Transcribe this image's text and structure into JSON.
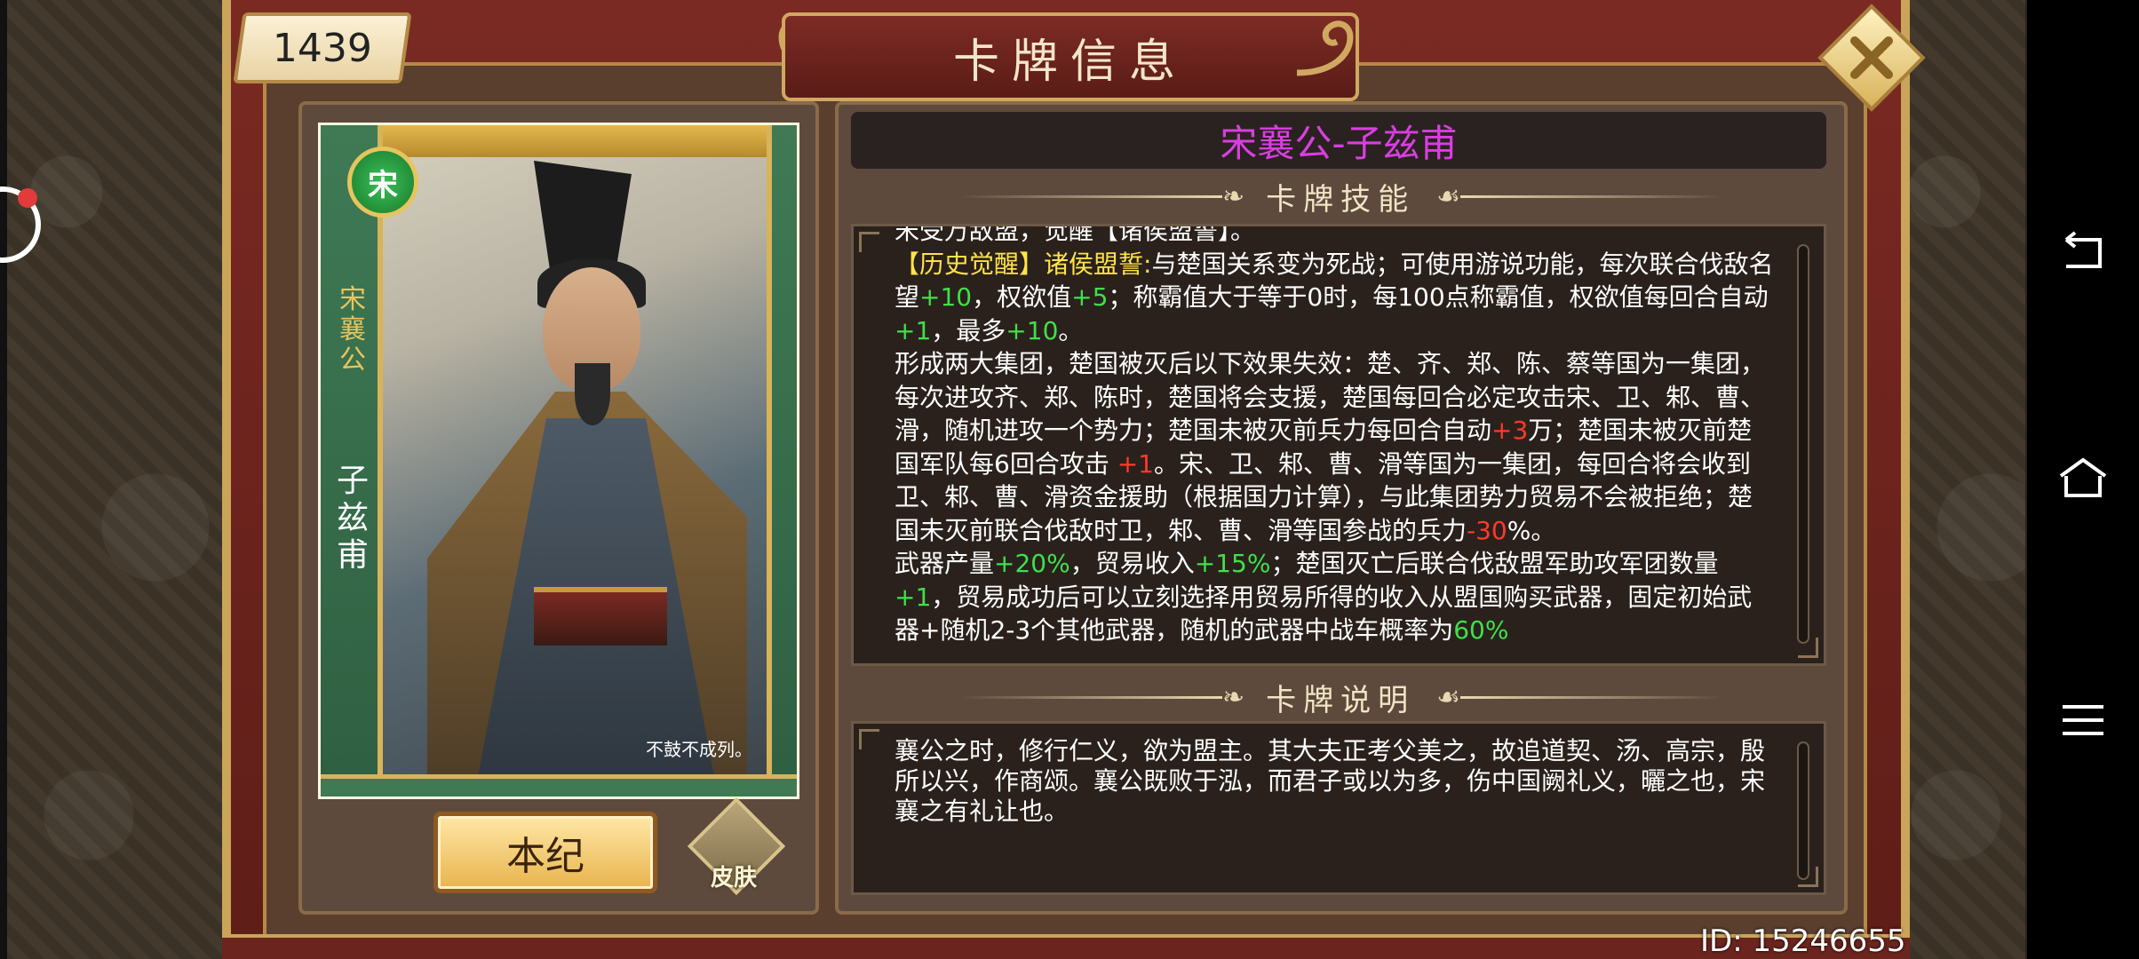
{
  "window": {
    "title": "卡牌信息"
  },
  "counter": {
    "value": "1439"
  },
  "card": {
    "name": "宋襄公-子兹甫",
    "nation_badge": "宋",
    "side_title": "宋襄公",
    "side_name": "子兹甫",
    "motto": "不鼓不成列。"
  },
  "buttons": {
    "benji": "本纪",
    "skin": "皮肤",
    "close_icon": "close-icon"
  },
  "sections": {
    "skills_title": "卡牌技能",
    "desc_title": "卡牌说明"
  },
  "skills": {
    "clipped_line": "宋受万敌盟，觉醒【诸侯盟誓】。",
    "awaken_tag": "【历史觉醒】",
    "awaken_name": "诸侯盟誓:",
    "p1_a": "与楚国关系变为死战；可使用游说功能，每次联合伐敌名望",
    "p1_b": "+10",
    "p1_c": "，权欲值",
    "p1_d": "+5",
    "p1_e": "；称霸值大于等于0时，每100点称霸值，权欲值每回合自动",
    "p1_f": "+1",
    "p1_g": "，最多",
    "p1_h": "+10",
    "p1_i": "。",
    "p2_a": "形成两大集团，楚国被灭后以下效果失效：楚、齐、郑、陈、蔡等国为一集团，每次进攻齐、郑、陈时，楚国将会支援，楚国每回合必定攻击宋、卫、邾、曹、滑，随机进攻一个势力；楚国未被灭前兵力每回合自动",
    "p2_b": "+3",
    "p2_c": "万；楚国未被灭前楚国军队每6回合攻击 ",
    "p2_d": "+1",
    "p2_e": "。宋、卫、邾、曹、滑等国为一集团，每回合将会收到卫、邾、曹、滑资金援助（根据国力计算），与此集团势力贸易不会被拒绝；楚国未灭前联合伐敌时卫，邾、曹、滑等国参战的兵力",
    "p2_f": "-30",
    "p2_g": "%。",
    "p3_a": "武器产量",
    "p3_b": "+20%",
    "p3_c": "，贸易收入",
    "p3_d": "+15%",
    "p3_e": "；楚国灭亡后联合伐敌盟军助攻军团数量",
    "p3_f": "+1",
    "p3_g": "，贸易成功后可以立刻选择用贸易所得的收入从盟国购买武器，固定初始武器+随机2-3个其他武器，随机的武器中战车概率为",
    "p3_h": "60%"
  },
  "description": {
    "text": "襄公之时，修行仁义，欲为盟主。其大夫正考父美之，故追道契、汤、高宗，殷所以兴，作商颂。襄公既败于泓，而君子或以为多，伤中国阙礼义，曬之也，宋襄之有礼让也。"
  },
  "footer": {
    "user_id": "ID: 15246655"
  },
  "colors": {
    "name": "#d83fe0",
    "highlight_yellow": "#ffe34a",
    "positive_green": "#3fe04a",
    "negative_red": "#ff3a2a"
  }
}
